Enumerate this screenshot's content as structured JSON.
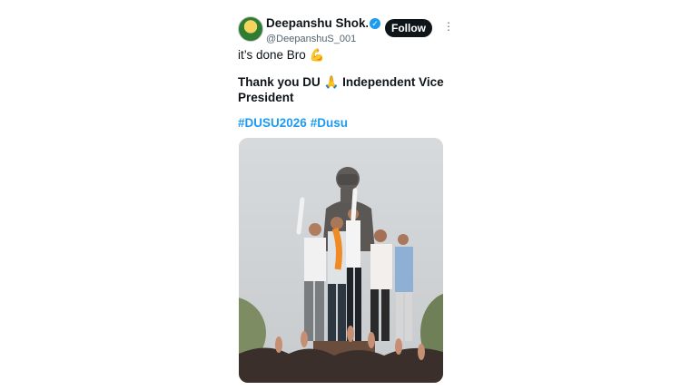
{
  "post": {
    "author": {
      "display_name": "Deepanshu Shok...",
      "handle": "@DeepanshuS_001",
      "verified_icon": "verified-badge-icon",
      "avatar_icon": "party-logo-avatar"
    },
    "follow_label": "Follow",
    "more_icon": "more-options-icon",
    "line1": "it’s done Bro 💪",
    "line2": "Thank you DU 🙏 Independent Vice President",
    "hashtags": [
      "#DUSU2026",
      "#Dusu"
    ],
    "media_icon": "statue-celebration-photo"
  },
  "colors": {
    "accent": "#1d9bf0",
    "text": "#0f1419",
    "follow_bg": "#0f1419"
  }
}
